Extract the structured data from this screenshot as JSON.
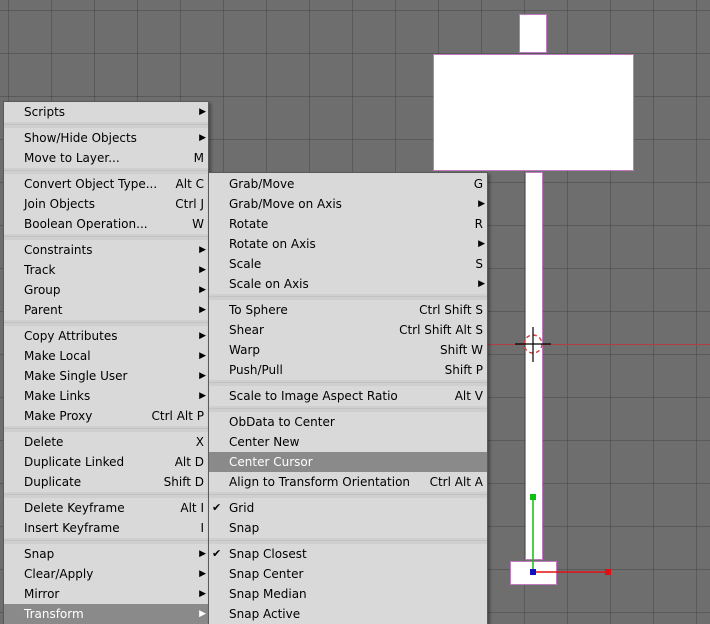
{
  "main_menu": {
    "groups": [
      [
        {
          "label": "Scripts",
          "arrow": true
        }
      ],
      [
        {
          "label": "Show/Hide Objects",
          "arrow": true
        },
        {
          "label": "Move to Layer...",
          "shortcut": "M"
        }
      ],
      [
        {
          "label": "Convert Object Type...",
          "shortcut": "Alt C"
        },
        {
          "label": "Join Objects",
          "shortcut": "Ctrl J"
        },
        {
          "label": "Boolean Operation...",
          "shortcut": "W"
        }
      ],
      [
        {
          "label": "Constraints",
          "arrow": true
        },
        {
          "label": "Track",
          "arrow": true
        },
        {
          "label": "Group",
          "arrow": true
        },
        {
          "label": "Parent",
          "arrow": true
        }
      ],
      [
        {
          "label": "Copy Attributes",
          "arrow": true
        },
        {
          "label": "Make Local",
          "arrow": true
        },
        {
          "label": "Make Single User",
          "arrow": true
        },
        {
          "label": "Make Links",
          "arrow": true
        },
        {
          "label": "Make Proxy",
          "shortcut": "Ctrl Alt P"
        }
      ],
      [
        {
          "label": "Delete",
          "shortcut": "X"
        },
        {
          "label": "Duplicate Linked",
          "shortcut": "Alt D"
        },
        {
          "label": "Duplicate",
          "shortcut": "Shift D"
        }
      ],
      [
        {
          "label": "Delete Keyframe",
          "shortcut": "Alt I"
        },
        {
          "label": "Insert Keyframe",
          "shortcut": "I"
        }
      ],
      [
        {
          "label": "Snap",
          "arrow": true
        },
        {
          "label": "Clear/Apply",
          "arrow": true
        },
        {
          "label": "Mirror",
          "arrow": true
        },
        {
          "label": "Transform",
          "arrow": true,
          "highlighted": true
        }
      ]
    ]
  },
  "transform_submenu": {
    "groups": [
      [
        {
          "label": "Grab/Move",
          "shortcut": "G"
        },
        {
          "label": "Grab/Move on Axis",
          "arrow": true
        },
        {
          "label": "Rotate",
          "shortcut": "R"
        },
        {
          "label": "Rotate on Axis",
          "arrow": true
        },
        {
          "label": "Scale",
          "shortcut": "S"
        },
        {
          "label": "Scale on Axis",
          "arrow": true
        }
      ],
      [
        {
          "label": "To Sphere",
          "shortcut": "Ctrl Shift S"
        },
        {
          "label": "Shear",
          "shortcut": "Ctrl Shift Alt S"
        },
        {
          "label": "Warp",
          "shortcut": "Shift W"
        },
        {
          "label": "Push/Pull",
          "shortcut": "Shift P"
        }
      ],
      [
        {
          "label": "Scale to Image Aspect Ratio",
          "shortcut": "Alt V"
        }
      ],
      [
        {
          "label": "ObData to Center"
        },
        {
          "label": "Center New"
        },
        {
          "label": "Center Cursor",
          "highlighted": true
        },
        {
          "label": "Align to Transform Orientation",
          "shortcut": "Ctrl Alt A"
        }
      ],
      [
        {
          "label": "Grid",
          "checked": true
        },
        {
          "label": "Snap"
        }
      ],
      [
        {
          "label": "Snap Closest",
          "checked": true
        },
        {
          "label": "Snap Center"
        },
        {
          "label": "Snap Median"
        },
        {
          "label": "Snap Active"
        }
      ]
    ]
  },
  "glyphs": {
    "arrow": "▶",
    "check": "✔"
  },
  "colors": {
    "viewport_bg": "#6e6e6e",
    "menu_bg": "#d9d9d9",
    "highlight_bg": "#8a8a8a",
    "object_outline": "#c07ac0",
    "axis_x": "#e01010",
    "axis_y": "#10c010",
    "axis_center": "#1010c0"
  }
}
